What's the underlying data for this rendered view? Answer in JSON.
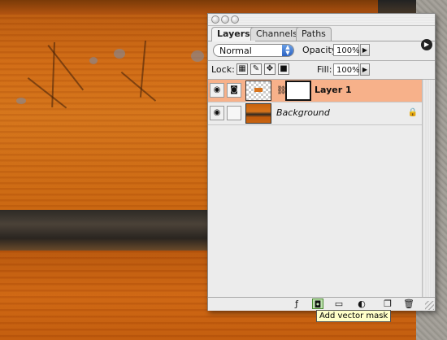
{
  "palette": {
    "tabs": [
      {
        "label": "Layers",
        "active": true
      },
      {
        "label": "Channels",
        "active": false
      },
      {
        "label": "Paths",
        "active": false
      }
    ],
    "menu_arrow": "▶",
    "blend_mode": "Normal",
    "opacity_label": "Opacity:",
    "opacity_value": "100%",
    "lock_label": "Lock:",
    "fill_label": "Fill:",
    "fill_value": "100%",
    "layers": [
      {
        "name": "Layer 1",
        "selected": true,
        "visible": true,
        "has_mask": true
      },
      {
        "name": "Background",
        "selected": false,
        "visible": true,
        "locked": true
      }
    ],
    "tooltip": "Add vector mask"
  },
  "icons": {
    "eye": "eye-icon",
    "brush": "brush-icon",
    "move": "move-icon",
    "lock": "lock-icon",
    "chain": "chain-link-icon",
    "layer_style": "layer-style-icon",
    "add_mask": "add-mask-icon",
    "new_set": "folder-icon",
    "adjustment": "adjustment-layer-icon",
    "new_layer": "new-layer-icon",
    "trash": "trash-icon"
  },
  "colors": {
    "selected_row": "#f7b18a",
    "palette_bg": "#ececec",
    "tooltip_bg": "#ffffc8"
  }
}
